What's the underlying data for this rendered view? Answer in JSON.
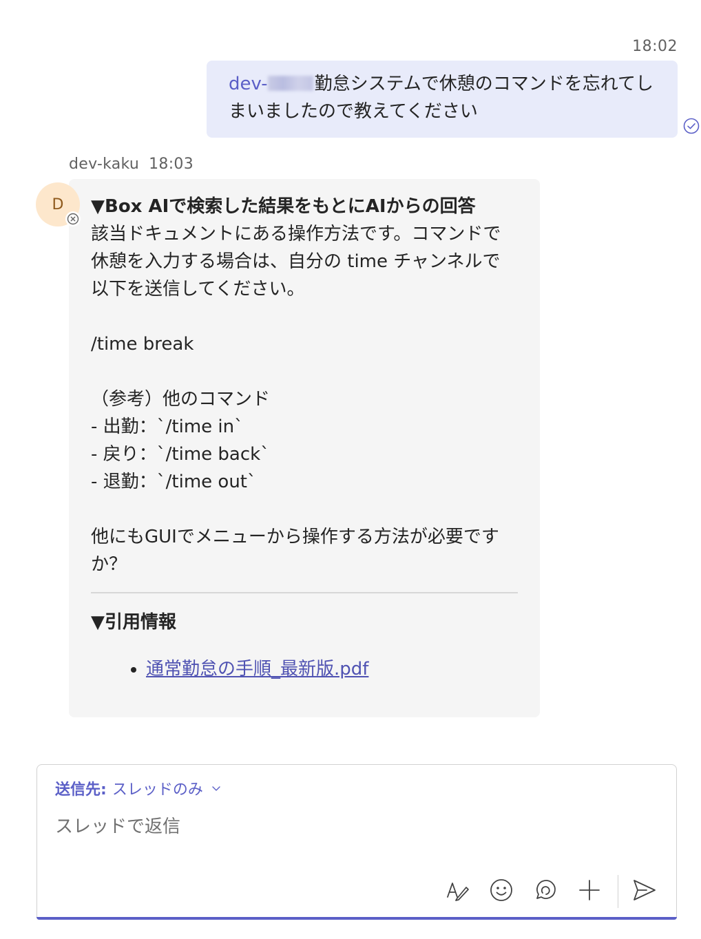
{
  "sent_message": {
    "time": "18:02",
    "mention": "dev-",
    "text_after_mention": "勤怠システムで休憩のコマンドを忘れてしまいましたので教えてください",
    "status_icon": "check-circle-icon"
  },
  "reply": {
    "sender": "dev-kaku",
    "time": "18:03",
    "avatar_initial": "D",
    "title": "▼Box AIで検索した結果をもとにAIからの回答",
    "intro": "該当ドキュメントにある操作方法です。コマンドで休憩を入力する場合は、自分の time チャンネルで以下を送信してください。",
    "command": "/time break",
    "other_heading": "（参考）他のコマンド",
    "other_commands": [
      "- 出勤：`/time in`",
      "- 戻り：`/time back`",
      "- 退勤：`/time out`"
    ],
    "followup": "他にもGUIでメニューから操作する方法が必要ですか？",
    "reference_title": "▼引用情報",
    "reference_link": "通常勤怠の手順_最新版.pdf"
  },
  "composer": {
    "recipient_label": "送信先:",
    "recipient_value": "スレッドのみ",
    "placeholder": "スレッドで返信",
    "tools": [
      "format-icon",
      "emoji-icon",
      "loop-icon",
      "plus-icon",
      "send-icon"
    ]
  },
  "colors": {
    "accent": "#5b5fc7",
    "sent_bubble": "#e8ebfa",
    "received_bubble": "#f5f5f5",
    "avatar_bg": "#fde7cc",
    "link": "#4f52b2"
  }
}
